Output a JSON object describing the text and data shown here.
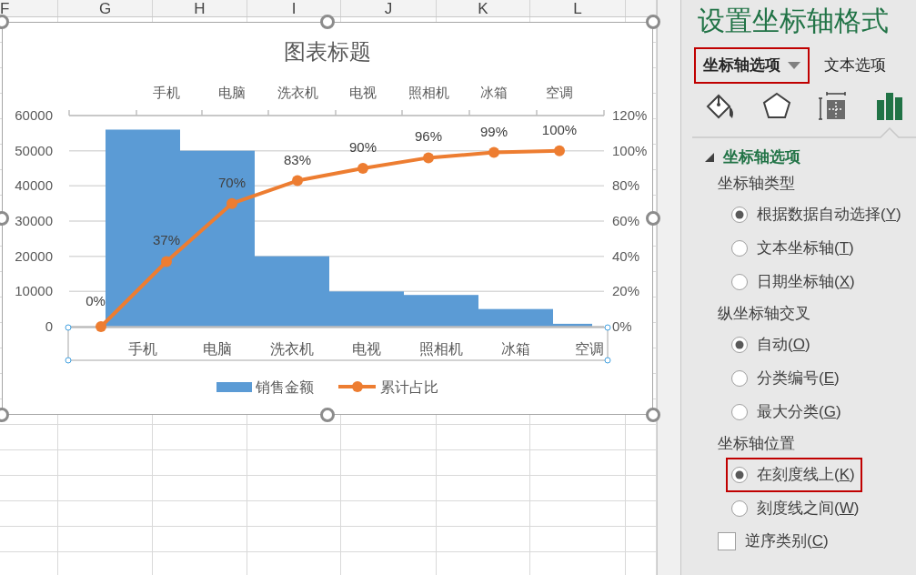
{
  "sheet": {
    "columns": [
      "F",
      "G",
      "H",
      "I",
      "J",
      "K",
      "L"
    ]
  },
  "chart": {
    "chart_data": {
      "type": "bar",
      "title": "图表标题",
      "categories": [
        "手机",
        "电脑",
        "洗衣机",
        "电视",
        "照相机",
        "冰箱",
        "空调"
      ],
      "series": [
        {
          "name": "销售金额",
          "color": "#5b9bd5",
          "values": [
            56000,
            50000,
            20000,
            10000,
            9000,
            5000,
            800
          ]
        }
      ],
      "grid": true,
      "legend": true,
      "ylim": [
        0,
        60000
      ],
      "yticks": [
        {
          "value": 0,
          "label": "0"
        },
        {
          "value": 10000,
          "label": "10000"
        },
        {
          "value": 20000,
          "label": "20000"
        },
        {
          "value": 30000,
          "label": "30000"
        },
        {
          "value": 40000,
          "label": "40000"
        },
        {
          "value": 50000,
          "label": "50000"
        },
        {
          "value": 60000,
          "label": "60000"
        }
      ]
    },
    "line_chart": {
      "chart_data": {
        "type": "line",
        "categories": [
          "手机",
          "电脑",
          "洗衣机",
          "电视",
          "照相机",
          "冰箱",
          "空调"
        ],
        "series": [
          {
            "name": "累计占比",
            "color": "#ed7d31",
            "marker": "circle",
            "values": [
              0.37,
              0.7,
              0.83,
              0.9,
              0.96,
              0.99,
              1
            ],
            "value_labels": [
              "37%",
              "70%",
              "83%",
              "90%",
              "96%",
              "99%",
              "100%"
            ]
          }
        ],
        "ylim": [
          0,
          1.2
        ],
        "yticks": [
          {
            "value": 0,
            "label": "0%"
          },
          {
            "value": 0.2,
            "label": "20%"
          },
          {
            "value": 0.4,
            "label": "40%"
          },
          {
            "value": 0.6,
            "label": "60%"
          },
          {
            "value": 0.8,
            "label": "80%"
          },
          {
            "value": 1.0,
            "label": "100%"
          },
          {
            "value": 1.2,
            "label": "120%"
          }
        ]
      },
      "start_label": "0%"
    },
    "bottom_axis_selected": true
  },
  "panel": {
    "title": "设置坐标轴格式",
    "tabs": [
      {
        "label": "坐标轴选项",
        "selected": true,
        "highlighted": true,
        "dropdown": true
      },
      {
        "label": "文本选项",
        "selected": false,
        "highlighted": false,
        "dropdown": false
      }
    ],
    "icon_tabs": [
      {
        "kind": "fill",
        "selected": false
      },
      {
        "kind": "effects",
        "selected": false
      },
      {
        "kind": "size",
        "selected": false
      },
      {
        "kind": "options",
        "selected": true
      }
    ],
    "section": {
      "title": "坐标轴选项",
      "expanded": true,
      "items": [
        {
          "kind": "heading",
          "label": "坐标轴类型"
        },
        {
          "kind": "radio",
          "label": "根据数据自动选择(Y)",
          "selected": true,
          "highlighted": false
        },
        {
          "kind": "radio",
          "label": "文本坐标轴(T)",
          "selected": false,
          "highlighted": false
        },
        {
          "kind": "radio",
          "label": "日期坐标轴(X)",
          "selected": false,
          "highlighted": false
        },
        {
          "kind": "heading",
          "label": "纵坐标轴交叉"
        },
        {
          "kind": "radio",
          "label": "自动(O)",
          "selected": true,
          "highlighted": false
        },
        {
          "kind": "radio",
          "label": "分类编号(E)",
          "selected": false,
          "highlighted": false
        },
        {
          "kind": "radio",
          "label": "最大分类(G)",
          "selected": false,
          "highlighted": false
        },
        {
          "kind": "heading",
          "label": "坐标轴位置"
        },
        {
          "kind": "radio",
          "label": "在刻度线上(K)",
          "selected": true,
          "highlighted": true
        },
        {
          "kind": "radio",
          "label": "刻度线之间(W)",
          "selected": false,
          "highlighted": false
        },
        {
          "kind": "checkbox",
          "label": "逆序类别(C)",
          "checked": false
        }
      ]
    }
  }
}
